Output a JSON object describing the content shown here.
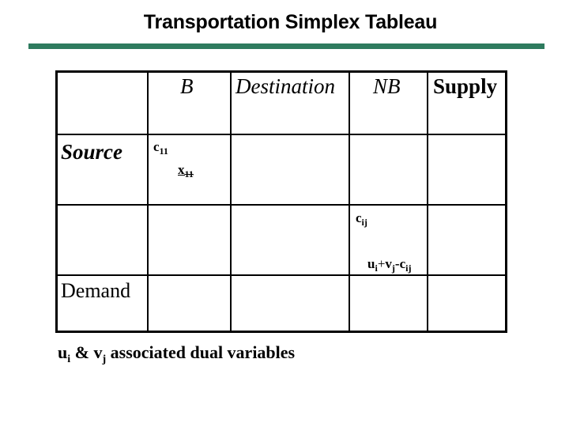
{
  "slide": {
    "title": "Transportation Simplex Tableau",
    "accent_color": "#2e7b5e"
  },
  "tableau": {
    "header": {
      "basic_label": "B",
      "destination_label": "Destination",
      "nonbasic_label": "NB",
      "supply_label": "Supply"
    },
    "rows": {
      "source_label": "Source",
      "demand_label": "Demand"
    },
    "basic_cell": {
      "cost": "c",
      "cost_sub": "11",
      "allocation": "x",
      "allocation_sub": "11"
    },
    "nonbasic_cell": {
      "cost": "c",
      "cost_sub": "ij",
      "reduced_u": "u",
      "reduced_u_sub": "i",
      "plus": "+",
      "reduced_v": "v",
      "reduced_v_sub": "j",
      "minus": "-",
      "reduced_c": "c",
      "reduced_c_sub": "ij"
    }
  },
  "caption": {
    "u": "u",
    "u_sub": "i",
    "amp": " & ",
    "v": "v",
    "v_sub": "j",
    "rest": " associated dual variables"
  }
}
